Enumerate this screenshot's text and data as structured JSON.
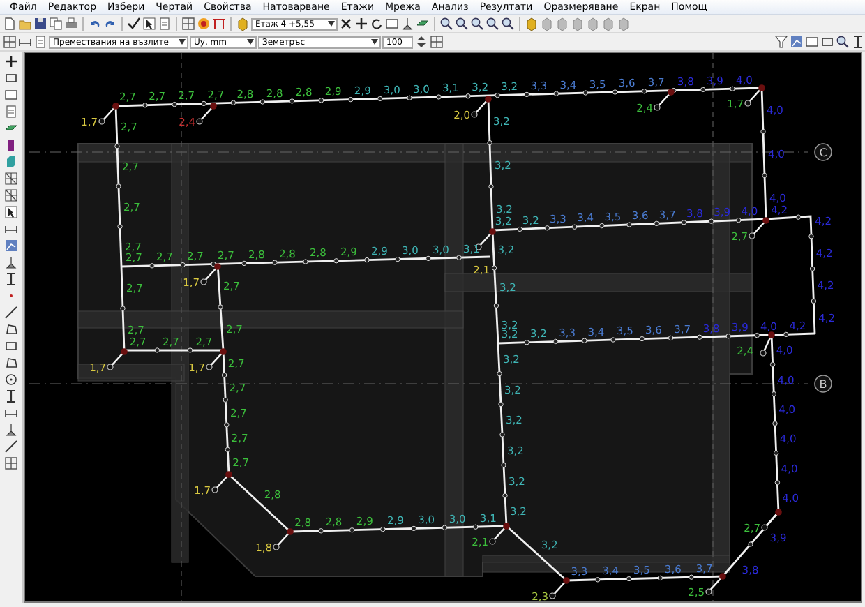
{
  "menu": [
    {
      "label": "Файл"
    },
    {
      "label": "Редактор"
    },
    {
      "label": "Избери"
    },
    {
      "label": "Чертай"
    },
    {
      "label": "Свойства"
    },
    {
      "label": "Натоварване"
    },
    {
      "label": "Етажи"
    },
    {
      "label": "Мрежа"
    },
    {
      "label": "Анализ"
    },
    {
      "label": "Резултати"
    },
    {
      "label": "Оразмеряване"
    },
    {
      "label": "Екран"
    },
    {
      "label": "Помощ"
    }
  ],
  "toolbar": {
    "floor_select": "Етаж 4 +5,55",
    "result_select": "Премествания на възлите",
    "component_select": "Uy, mm",
    "load_case_select": "Земетръс",
    "scale_field": "100"
  },
  "axes": [
    {
      "label": "C"
    },
    {
      "label": "B"
    }
  ],
  "strips": [
    {
      "labels": [
        {
          "text": "2,7",
          "color": "#3cbf3c"
        },
        {
          "text": "2,7",
          "color": "#3cbf3c"
        },
        {
          "text": "2,7",
          "color": "#3cbf3c"
        },
        {
          "text": "2,7",
          "color": "#3cbf3c"
        },
        {
          "text": "2,8",
          "color": "#3cbf3c"
        },
        {
          "text": "2,8",
          "color": "#3cbf3c"
        },
        {
          "text": "2,8",
          "color": "#3cbf3c"
        },
        {
          "text": "2,9",
          "color": "#3cbf3c"
        },
        {
          "text": "2,9",
          "color": "#3fb5b5"
        },
        {
          "text": "3,0",
          "color": "#3fb5b5"
        },
        {
          "text": "3,0",
          "color": "#3fb5b5"
        },
        {
          "text": "3,1",
          "color": "#3fb5b5"
        },
        {
          "text": "3,2",
          "color": "#3fb5b5"
        },
        {
          "text": "3,2",
          "color": "#3fb5b5"
        },
        {
          "text": "3,3",
          "color": "#4a7bd0"
        },
        {
          "text": "3,4",
          "color": "#4a7bd0"
        },
        {
          "text": "3,5",
          "color": "#4a7bd0"
        },
        {
          "text": "3,6",
          "color": "#4a7bd0"
        },
        {
          "text": "3,7",
          "color": "#4a7bd0"
        },
        {
          "text": "3,8",
          "color": "#2a2ad8"
        },
        {
          "text": "3,9",
          "color": "#2a2ad8"
        },
        {
          "text": "4,0",
          "color": "#2a2ad8"
        }
      ]
    },
    {
      "labels": [
        {
          "text": "4,0",
          "color": "#2a2ad8"
        },
        {
          "text": "4,0",
          "color": "#2a2ad8"
        },
        {
          "text": "4,0",
          "color": "#2a2ad8"
        }
      ]
    },
    {
      "labels": [
        {
          "text": "3,2",
          "color": "#3fb5b5"
        },
        {
          "text": "3,2",
          "color": "#3fb5b5"
        },
        {
          "text": "3,2",
          "color": "#3fb5b5"
        }
      ]
    },
    {
      "labels": [
        {
          "text": "2,7",
          "color": "#3cbf3c"
        },
        {
          "text": "2,7",
          "color": "#3cbf3c"
        },
        {
          "text": "2,7",
          "color": "#3cbf3c"
        },
        {
          "text": "2,7",
          "color": "#3cbf3c"
        }
      ]
    },
    {
      "labels": [
        {
          "text": "3,2",
          "color": "#3fb5b5"
        },
        {
          "text": "3,2",
          "color": "#3fb5b5"
        },
        {
          "text": "3,3",
          "color": "#4a7bd0"
        },
        {
          "text": "3,4",
          "color": "#4a7bd0"
        },
        {
          "text": "3,5",
          "color": "#4a7bd0"
        },
        {
          "text": "3,6",
          "color": "#4a7bd0"
        },
        {
          "text": "3,7",
          "color": "#4a7bd0"
        },
        {
          "text": "3,8",
          "color": "#2a2ad8"
        },
        {
          "text": "3,9",
          "color": "#2a2ad8"
        },
        {
          "text": "4,0",
          "color": "#2a2ad8"
        }
      ]
    },
    {
      "labels": [
        {
          "text": "4,2",
          "color": "#2a2ad8"
        },
        {
          "text": "4,2",
          "color": "#2a2ad8"
        },
        {
          "text": "4,2",
          "color": "#2a2ad8"
        },
        {
          "text": "4,2",
          "color": "#2a2ad8"
        },
        {
          "text": "4,2",
          "color": "#2a2ad8"
        }
      ]
    },
    {
      "labels": [
        {
          "text": "2,7",
          "color": "#3cbf3c"
        },
        {
          "text": "2,7",
          "color": "#3cbf3c"
        },
        {
          "text": "2,7",
          "color": "#3cbf3c"
        },
        {
          "text": "2,7",
          "color": "#3cbf3c"
        },
        {
          "text": "2,8",
          "color": "#3cbf3c"
        },
        {
          "text": "2,8",
          "color": "#3cbf3c"
        },
        {
          "text": "2,8",
          "color": "#3cbf3c"
        },
        {
          "text": "2,9",
          "color": "#3cbf3c"
        },
        {
          "text": "2,9",
          "color": "#3fb5b5"
        },
        {
          "text": "3,0",
          "color": "#3fb5b5"
        },
        {
          "text": "3,0",
          "color": "#3fb5b5"
        },
        {
          "text": "3,1",
          "color": "#3fb5b5"
        }
      ]
    },
    {
      "labels": [
        {
          "text": "2,7",
          "color": "#3cbf3c"
        },
        {
          "text": "2,7",
          "color": "#3cbf3c"
        }
      ]
    },
    {
      "labels": [
        {
          "text": "2,7",
          "color": "#3cbf3c"
        },
        {
          "text": "2,7",
          "color": "#3cbf3c"
        }
      ]
    },
    {
      "labels": [
        {
          "text": "3,2",
          "color": "#3fb5b5"
        },
        {
          "text": "3,2",
          "color": "#3fb5b5"
        },
        {
          "text": "3,2",
          "color": "#3fb5b5"
        }
      ]
    },
    {
      "labels": [
        {
          "text": "3,2",
          "color": "#3fb5b5"
        },
        {
          "text": "3,2",
          "color": "#3fb5b5"
        },
        {
          "text": "3,3",
          "color": "#4a7bd0"
        },
        {
          "text": "3,4",
          "color": "#4a7bd0"
        },
        {
          "text": "3,5",
          "color": "#4a7bd0"
        },
        {
          "text": "3,6",
          "color": "#4a7bd0"
        },
        {
          "text": "3,7",
          "color": "#4a7bd0"
        },
        {
          "text": "3,8",
          "color": "#2a2ad8"
        },
        {
          "text": "3,9",
          "color": "#2a2ad8"
        },
        {
          "text": "4,0",
          "color": "#2a2ad8"
        },
        {
          "text": "4,2",
          "color": "#2a2ad8"
        }
      ]
    },
    {
      "labels": [
        {
          "text": "4,0",
          "color": "#2a2ad8"
        },
        {
          "text": "4,0",
          "color": "#2a2ad8"
        },
        {
          "text": "4,0",
          "color": "#2a2ad8"
        },
        {
          "text": "4,0",
          "color": "#2a2ad8"
        },
        {
          "text": "4,0",
          "color": "#2a2ad8"
        },
        {
          "text": "4,0",
          "color": "#2a2ad8"
        }
      ]
    },
    {
      "labels": [
        {
          "text": "3,2",
          "color": "#3fb5b5"
        },
        {
          "text": "3,2",
          "color": "#3fb5b5"
        },
        {
          "text": "3,2",
          "color": "#3fb5b5"
        },
        {
          "text": "3,2",
          "color": "#3fb5b5"
        },
        {
          "text": "3,2",
          "color": "#3fb5b5"
        },
        {
          "text": "3,2",
          "color": "#3fb5b5"
        }
      ]
    },
    {
      "labels": [
        {
          "text": "2,7",
          "color": "#3cbf3c"
        },
        {
          "text": "2,7",
          "color": "#3cbf3c"
        },
        {
          "text": "2,7",
          "color": "#3cbf3c"
        }
      ]
    },
    {
      "labels": [
        {
          "text": "2,7",
          "color": "#3cbf3c"
        },
        {
          "text": "2,7",
          "color": "#3cbf3c"
        },
        {
          "text": "2,7",
          "color": "#3cbf3c"
        },
        {
          "text": "2,7",
          "color": "#3cbf3c"
        },
        {
          "text": "2,7",
          "color": "#3cbf3c"
        }
      ]
    },
    {
      "labels": [
        {
          "text": "2,8",
          "color": "#3cbf3c"
        }
      ]
    },
    {
      "labels": [
        {
          "text": "3,8",
          "color": "#2a2ad8"
        },
        {
          "text": "3,9",
          "color": "#2a2ad8"
        }
      ]
    },
    {
      "labels": [
        {
          "text": "2,8",
          "color": "#3cbf3c"
        },
        {
          "text": "2,8",
          "color": "#3cbf3c"
        },
        {
          "text": "2,9",
          "color": "#3cbf3c"
        },
        {
          "text": "2,9",
          "color": "#3fb5b5"
        },
        {
          "text": "3,0",
          "color": "#3fb5b5"
        },
        {
          "text": "3,0",
          "color": "#3fb5b5"
        },
        {
          "text": "3,1",
          "color": "#3fb5b5"
        }
      ]
    },
    {
      "labels": [
        {
          "text": "3,2",
          "color": "#3fb5b5"
        }
      ]
    },
    {
      "labels": [
        {
          "text": "3,3",
          "color": "#4a7bd0"
        },
        {
          "text": "3,4",
          "color": "#4a7bd0"
        },
        {
          "text": "3,5",
          "color": "#4a7bd0"
        },
        {
          "text": "3,6",
          "color": "#4a7bd0"
        },
        {
          "text": "3,7",
          "color": "#4a7bd0"
        }
      ]
    }
  ],
  "supports": [
    {
      "label": "1,7",
      "color": "#d8c840"
    },
    {
      "label": "2,4",
      "color": "#c83030"
    },
    {
      "label": "2,0",
      "color": "#d8c840"
    },
    {
      "label": "2,4",
      "color": "#3cbf3c"
    },
    {
      "label": "1,7",
      "color": "#3cbf3c"
    },
    {
      "label": "1,7",
      "color": "#d8c840"
    },
    {
      "label": "2,1",
      "color": "#d8c840"
    },
    {
      "label": "2,7",
      "color": "#3cbf3c"
    },
    {
      "label": "1,7",
      "color": "#d8c840"
    },
    {
      "label": "1,7",
      "color": "#d8c840"
    },
    {
      "label": "1,7",
      "color": "#d8c840"
    },
    {
      "label": "1,8",
      "color": "#d8c840"
    },
    {
      "label": "2,1",
      "color": "#3cbf3c"
    },
    {
      "label": "2,3",
      "color": "#a8c840"
    },
    {
      "label": "2,5",
      "color": "#3cbf3c"
    },
    {
      "label": "2,4",
      "color": "#3cbf3c"
    },
    {
      "label": "2,7",
      "color": "#3cbf3c"
    }
  ]
}
